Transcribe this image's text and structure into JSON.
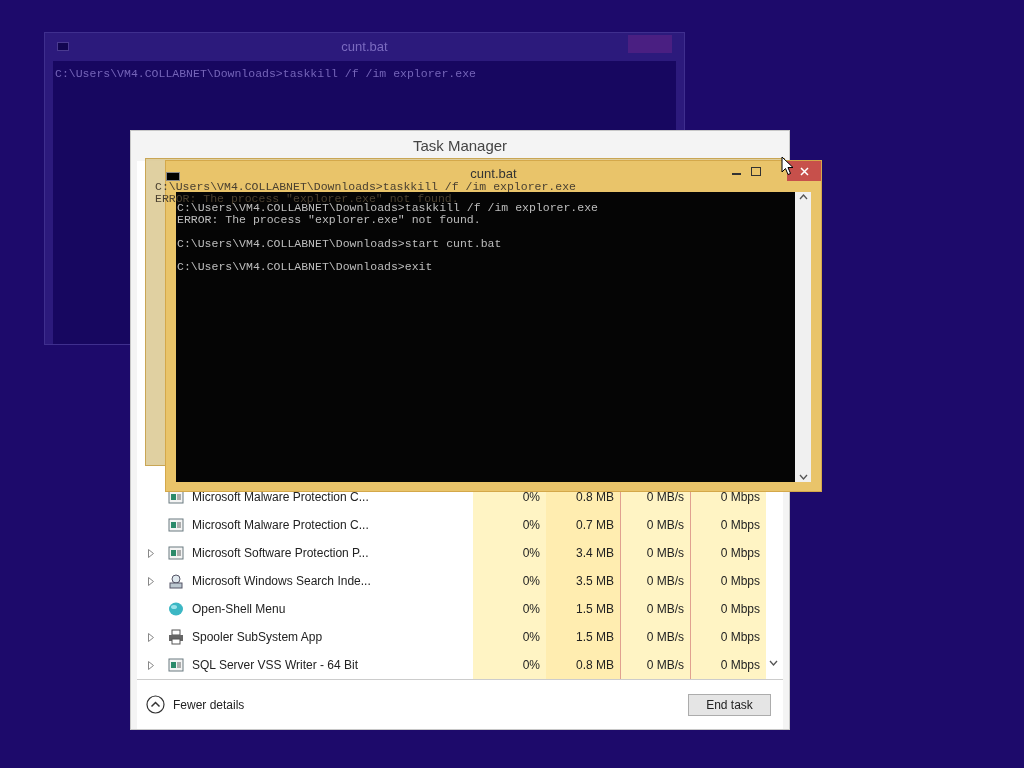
{
  "background_window": {
    "title": "cunt.bat",
    "lines": [
      "C:\\Users\\VM4.COLLABNET\\Downloads>taskkill /f /im explorer.exe"
    ]
  },
  "task_manager": {
    "title": "Task Manager",
    "rows": [
      {
        "name": "Microsoft Malware Protection C...",
        "expandable": false,
        "kind": "service",
        "cpu": "0%",
        "memory": "0.8 MB",
        "disk": "0 MB/s",
        "network": "0 Mbps"
      },
      {
        "name": "Microsoft Malware Protection C...",
        "expandable": false,
        "kind": "service",
        "cpu": "0%",
        "memory": "0.7 MB",
        "disk": "0 MB/s",
        "network": "0 Mbps"
      },
      {
        "name": "Microsoft Software Protection P...",
        "expandable": true,
        "kind": "service",
        "cpu": "0%",
        "memory": "3.4 MB",
        "disk": "0 MB/s",
        "network": "0 Mbps"
      },
      {
        "name": "Microsoft Windows Search Inde...",
        "expandable": true,
        "kind": "search",
        "cpu": "0%",
        "memory": "3.5 MB",
        "disk": "0 MB/s",
        "network": "0 Mbps"
      },
      {
        "name": "Open-Shell Menu",
        "expandable": false,
        "kind": "shell",
        "cpu": "0%",
        "memory": "1.5 MB",
        "disk": "0 MB/s",
        "network": "0 Mbps"
      },
      {
        "name": "Spooler SubSystem App",
        "expandable": true,
        "kind": "printer",
        "cpu": "0%",
        "memory": "1.5 MB",
        "disk": "0 MB/s",
        "network": "0 Mbps"
      },
      {
        "name": "SQL Server VSS Writer - 64 Bit",
        "expandable": true,
        "kind": "service",
        "cpu": "0%",
        "memory": "0.8 MB",
        "disk": "0 MB/s",
        "network": "0 Mbps"
      }
    ],
    "fewer_details": "Fewer details",
    "end_task": "End task"
  },
  "ghost_console": {
    "lines": [
      "C:\\Users\\VM4.COLLABNET\\Downloads>taskkill /f /im explorer.exe",
      "ERROR: The process \"explorer.exe\" not found."
    ]
  },
  "console": {
    "title": "cunt.bat",
    "blocks": [
      {
        "lines": [
          "C:\\Users\\VM4.COLLABNET\\Downloads>taskkill /f /im explorer.exe",
          "ERROR: The process \"explorer.exe\" not found."
        ]
      },
      {
        "lines": [
          "C:\\Users\\VM4.COLLABNET\\Downloads>start cunt.bat"
        ]
      },
      {
        "lines": [
          "C:\\Users\\VM4.COLLABNET\\Downloads>exit"
        ]
      }
    ]
  }
}
